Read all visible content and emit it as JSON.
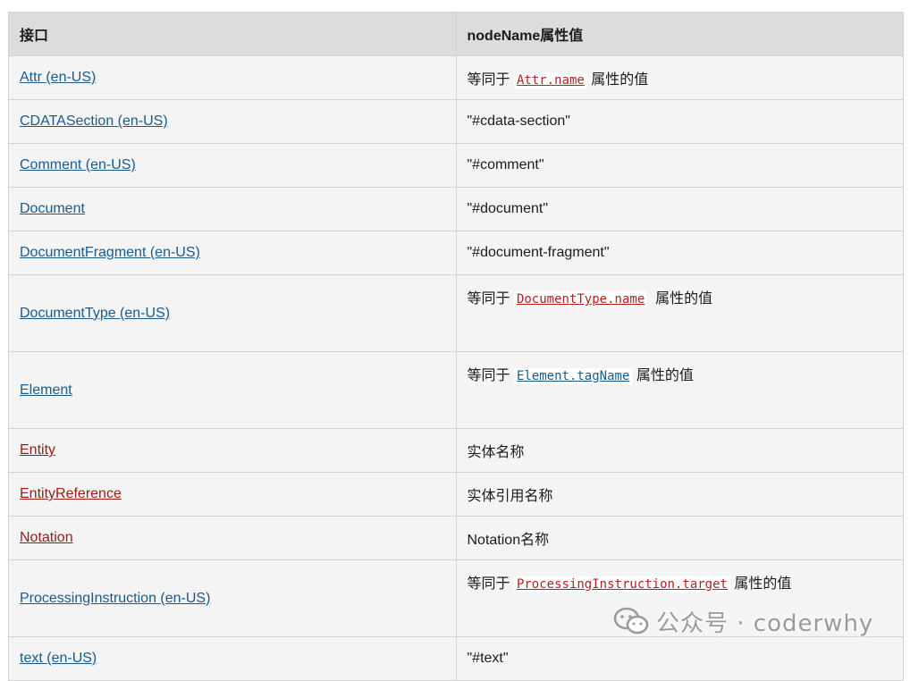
{
  "table": {
    "headers": {
      "interface": "接口",
      "node_name": "nodeName属性值"
    },
    "rows": [
      {
        "name": "Attr (en-US)",
        "link": "ok",
        "tall": false,
        "value": {
          "before": "等同于 ",
          "code": "Attr.name",
          "code_link": "missing",
          "after": " 属性的值"
        }
      },
      {
        "name": "CDATASection (en-US)",
        "link": "ok",
        "tall": false,
        "value": {
          "text": "\"#cdata-section\""
        }
      },
      {
        "name": "Comment (en-US)",
        "link": "ok",
        "tall": false,
        "value": {
          "text": "\"#comment\""
        }
      },
      {
        "name": "Document",
        "link": "ok",
        "tall": false,
        "value": {
          "text": "\"#document\""
        }
      },
      {
        "name": "DocumentFragment (en-US)",
        "link": "ok",
        "tall": false,
        "value": {
          "text": "\"#document-fragment\""
        }
      },
      {
        "name": "DocumentType (en-US)",
        "link": "ok",
        "tall": true,
        "value": {
          "before": "等同于 ",
          "code": "DocumentType.name",
          "code_link": "missing",
          "after": "  属性的值"
        }
      },
      {
        "name": "Element",
        "link": "ok",
        "tall": true,
        "value": {
          "before": "等同于 ",
          "code": "Element.tagName",
          "code_link": "ok",
          "after": " 属性的值"
        }
      },
      {
        "name": "Entity",
        "link": "missing",
        "tall": false,
        "value": {
          "text": "实体名称"
        }
      },
      {
        "name": "EntityReference",
        "link": "missing",
        "tall": false,
        "value": {
          "text": "实体引用名称"
        }
      },
      {
        "name": "Notation",
        "link": "missing",
        "tall": false,
        "value": {
          "text": "Notation名称"
        }
      },
      {
        "name": "ProcessingInstruction (en-US)",
        "link": "ok",
        "tall": true,
        "value": {
          "before": "等同于 ",
          "code": "ProcessingInstruction.target",
          "code_link": "missing",
          "after": " 属性的值"
        }
      },
      {
        "name": "text (en-US)",
        "link": "ok",
        "tall": false,
        "value": {
          "text": "\"#text\""
        }
      }
    ]
  },
  "watermark": {
    "icon": "wechat-icon",
    "text": "公众号 · coderwhy"
  },
  "colors": {
    "link": "#1a5a8a",
    "missing_link": "#9b1a1a",
    "header_bg": "#dcdcdc",
    "cell_bg": "#f4f4f4",
    "border": "#d4d4d4"
  }
}
